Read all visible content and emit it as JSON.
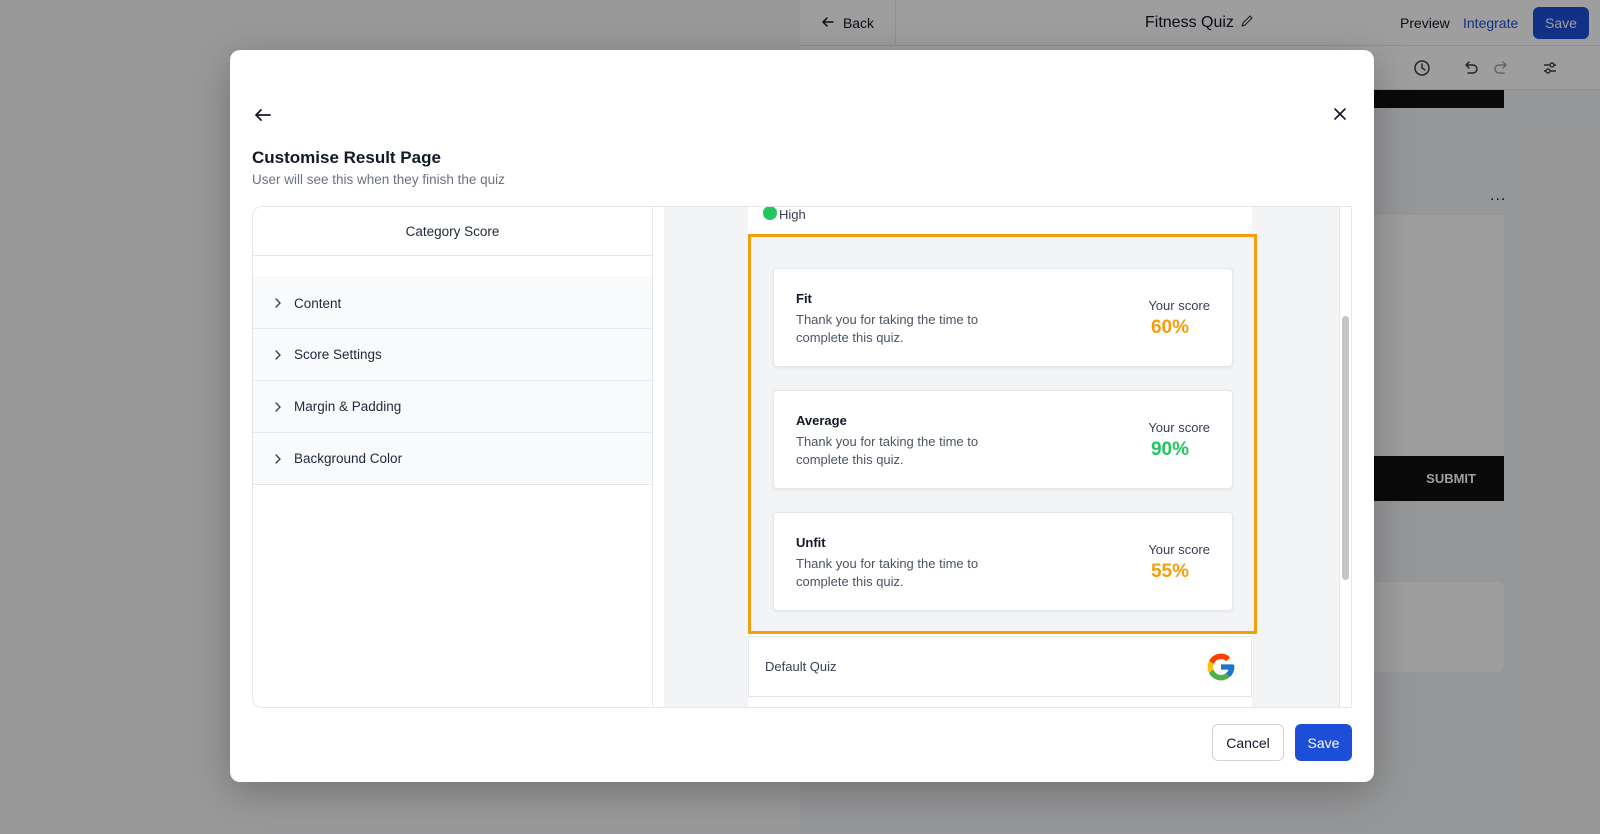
{
  "background_app": {
    "back_label": "Back",
    "title": "Fitness Quiz",
    "preview_label": "Preview",
    "integrate_label": "Integrate",
    "save_label": "Save",
    "submit_label": "SUBMIT",
    "more_label": "..."
  },
  "modal": {
    "title": "Customise Result Page",
    "subtitle": "User will see this when they finish the quiz",
    "settings": {
      "header": "Category Score",
      "items": [
        {
          "label": "Content"
        },
        {
          "label": "Score Settings"
        },
        {
          "label": "Margin & Padding"
        },
        {
          "label": "Background Color"
        }
      ]
    },
    "preview": {
      "legend_label": "High",
      "cards": [
        {
          "title": "Fit",
          "description": "Thank you for taking the time to complete this quiz.",
          "score_label": "Your score",
          "score": "60%",
          "score_color": "#f59e0b"
        },
        {
          "title": "Average",
          "description": "Thank you for taking the time to complete this quiz.",
          "score_label": "Your score",
          "score": "90%",
          "score_color": "#22c55e"
        },
        {
          "title": "Unfit",
          "description": "Thank you for taking the time to complete this quiz.",
          "score_label": "Your score",
          "score": "55%",
          "score_color": "#f59e0b"
        }
      ],
      "footer_label": "Default Quiz",
      "footer_icon": "google-logo"
    },
    "cancel_label": "Cancel",
    "save_label": "Save"
  },
  "colors": {
    "accent_blue": "#1d4ed8",
    "highlight_orange": "#f59e0b",
    "success_green": "#22c55e"
  }
}
